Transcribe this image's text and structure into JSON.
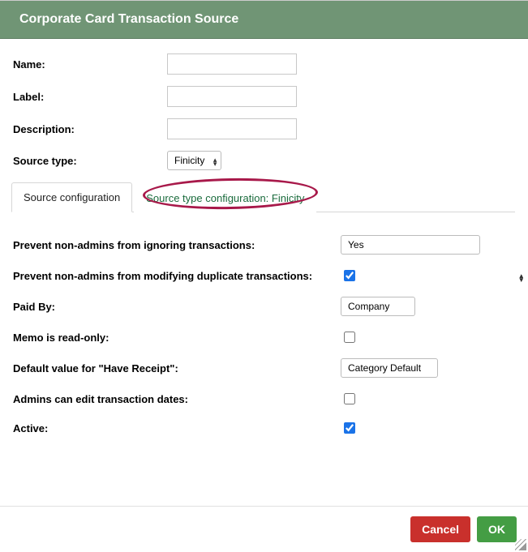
{
  "title": "Corporate Card Transaction Source",
  "topForm": {
    "name": {
      "label": "Name:",
      "value": ""
    },
    "labelField": {
      "label": "Label:",
      "value": ""
    },
    "description": {
      "label": "Description:",
      "value": ""
    },
    "sourceType": {
      "label": "Source type:",
      "value": "Finicity"
    }
  },
  "tabs": {
    "config": "Source configuration",
    "typeConfig": "Source type configuration: Finicity"
  },
  "settings": {
    "preventIgnore": {
      "label": "Prevent non-admins from ignoring transactions:",
      "value": "Yes"
    },
    "preventDup": {
      "label": "Prevent non-admins from modifying duplicate transactions:",
      "checked": true
    },
    "paidBy": {
      "label": "Paid By:",
      "value": "Company"
    },
    "memoReadonly": {
      "label": "Memo is read-only:",
      "checked": false
    },
    "haveReceipt": {
      "label": "Default value for \"Have Receipt\":",
      "value": "Category Default"
    },
    "adminsEditDates": {
      "label": "Admins can edit transaction dates:",
      "checked": false
    },
    "active": {
      "label": "Active:",
      "checked": true
    }
  },
  "buttons": {
    "cancel": "Cancel",
    "ok": "OK"
  }
}
